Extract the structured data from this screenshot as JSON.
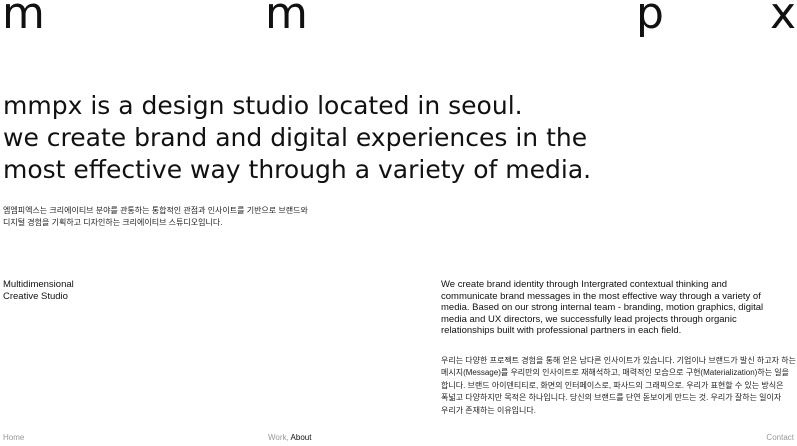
{
  "logo": {
    "letters": [
      "m",
      "m",
      "p",
      "x"
    ]
  },
  "headline": {
    "lines": [
      "mmpx is a design studio located in seoul.",
      "we create brand and digital experiences in the",
      "most effective way through a variety of media."
    ]
  },
  "intro_ko": {
    "lines": [
      "엠엠피엑스는 크리에이티브 분야를 관통하는 통합적인 관점과 인사이트를 기반으로 브랜드와",
      "디지털 경험을 기획하고 디자인하는 크리에이티브 스튜디오입니다."
    ]
  },
  "tagline": {
    "lines": [
      "Multidimensional",
      "Creative Studio"
    ]
  },
  "description_en": {
    "lines": [
      "We create brand identity through Intergrated contextual thinking and",
      "communicate brand messages in the most effective way through a variety of",
      "media. Based on our strong internal team - branding, motion graphics, digital",
      "media and UX directors, we successfully lead projects through organic",
      "relationships built with professional partners in each field."
    ]
  },
  "description_ko": {
    "lines": [
      "우리는 다양한 프로젝트 경험을 통해 얻은 남다른 인사이트가 있습니다. 기업이나 브랜드가 발신 하고자 하는",
      "메시지(Message)를 우리만의 인사이트로 재해석하고, 매력적인 모습으로 구현(Materialization)하는 일을",
      "합니다. 브랜드 아이덴티티로, 화면의 인터페이스로, 파사드의 그래픽으로. 우리가 표현할 수 있는 방식은",
      "폭넓고 다양하지만 목적은 하나입니다. 당신의 브랜드를 단연 돋보이게 만드는 것. 우리가 잘하는 일이자",
      "우리가 존재하는 이유입니다."
    ]
  },
  "footer": {
    "home": "Home",
    "work": "Work",
    "separator": ",",
    "about": "About",
    "contact": "Contact"
  }
}
